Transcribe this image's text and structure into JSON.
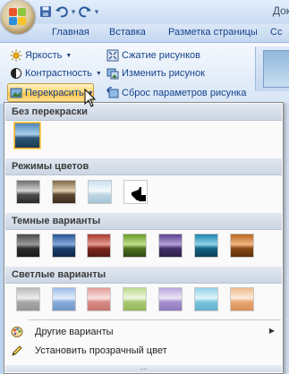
{
  "window": {
    "title": "Док"
  },
  "qat": {
    "items": [
      "save-icon",
      "undo-icon",
      "redo-icon",
      "customize-icon"
    ]
  },
  "tabs": [
    "Главная",
    "Вставка",
    "Разметка страницы",
    "Сс"
  ],
  "ribbon": {
    "brightness": "Яркость",
    "contrast": "Контрастность",
    "recolor": "Перекрасить",
    "compress": "Сжатие рисунков",
    "change_picture": "Изменить рисунок",
    "reset_picture": "Сброс параметров рисунка"
  },
  "menu": {
    "no_recolor": "Без перекраски",
    "color_modes": "Режимы цветов",
    "dark_variants": "Темные варианты",
    "light_variants": "Светлые варианты",
    "more_variants": "Другие варианты",
    "set_transparent": "Установить прозрачный цвет",
    "grip": "....",
    "swatch_colors": {
      "color_modes": [
        "grayscale",
        "sepia",
        "washout",
        "black-and-white"
      ],
      "dark": [
        "#3a3a3a",
        "#1f4e8c",
        "#b3342c",
        "#6f9b2e",
        "#6a4a9c",
        "#1f8bb0",
        "#c8682a",
        "#3d6fb3"
      ],
      "light": [
        "#c9c9c9",
        "#a9c6ea",
        "#ecaaa6",
        "#c6df9d",
        "#c4b3e0",
        "#9fd8ea",
        "#f4c49a",
        "#b8cdee"
      ]
    }
  }
}
